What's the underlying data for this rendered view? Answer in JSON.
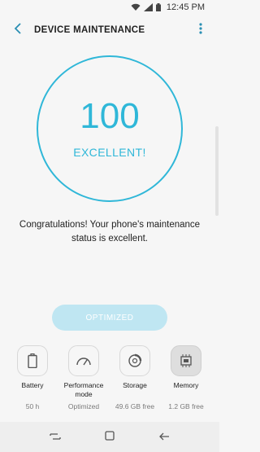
{
  "status_bar": {
    "time": "12:45 PM",
    "icons": [
      "wifi-icon",
      "signal-icon",
      "battery-icon"
    ]
  },
  "app_bar": {
    "title": "DEVICE MAINTENANCE",
    "back_icon": "back-arrow-icon",
    "more_icon": "more-vert-icon"
  },
  "score": {
    "value": "100",
    "label": "EXCELLENT!"
  },
  "message": {
    "line1": "Congratulations! Your phone's maintenance",
    "line2": "status is excellent."
  },
  "optimize_button": {
    "label": "OPTIMIZED"
  },
  "items": [
    {
      "label": "Battery",
      "value": "50 h",
      "icon": "battery-icon"
    },
    {
      "label": "Performance mode",
      "value": "Optimized",
      "icon": "speedometer-icon"
    },
    {
      "label": "Storage",
      "value": "49.6 GB free",
      "icon": "storage-icon"
    },
    {
      "label": "Memory",
      "value": "1.2 GB free",
      "icon": "memory-chip-icon"
    }
  ],
  "nav_bar": {
    "icons": [
      "recent-apps-icon",
      "home-icon",
      "back-icon"
    ]
  },
  "colors": {
    "accent": "#2fb7d8",
    "button_disabled": "#bfe6f2",
    "back_arrow": "#2a8fb3"
  }
}
